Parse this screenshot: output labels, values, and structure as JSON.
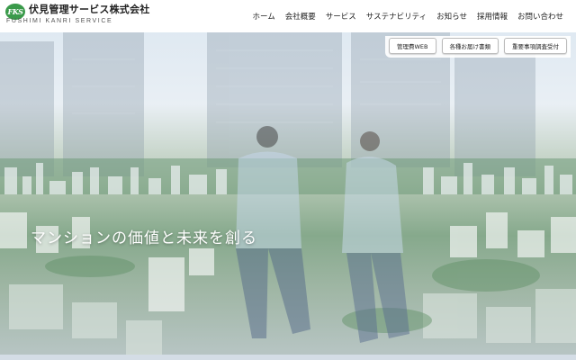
{
  "brand": {
    "badge": "FKS",
    "name_jp": "伏見管理サービス株式会社",
    "name_en": "FUSHIMI KANRI SERVICE",
    "color": "#3a9a4a"
  },
  "nav": {
    "items": [
      {
        "label": "ホーム"
      },
      {
        "label": "会社概要"
      },
      {
        "label": "サービス"
      },
      {
        "label": "サステナビリティ"
      },
      {
        "label": "お知らせ"
      },
      {
        "label": "採用情報"
      },
      {
        "label": "お問い合わせ"
      }
    ]
  },
  "sub_buttons": [
    {
      "label": "管理費WEB"
    },
    {
      "label": "各種お届け書類"
    },
    {
      "label": "重要事項調査受付"
    }
  ],
  "hero": {
    "tagline": "マンションの価値と未来を創る"
  }
}
